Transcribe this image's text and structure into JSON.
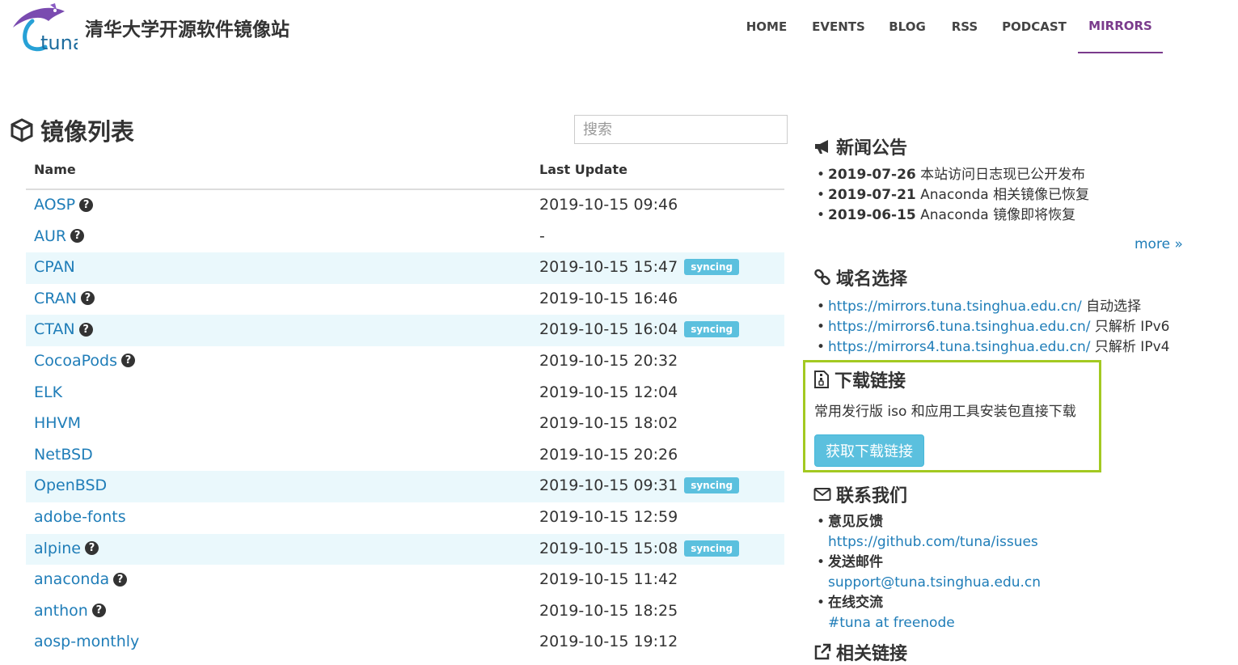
{
  "header": {
    "logo_text": "tuna",
    "site_title": "清华大学开源软件镜像站",
    "nav": [
      "HOME",
      "EVENTS",
      "BLOG",
      "RSS",
      "PODCAST",
      "MIRRORS"
    ],
    "active_nav": "MIRRORS"
  },
  "mirror_list": {
    "title": "镜像列表",
    "search_placeholder": "搜索",
    "col_name": "Name",
    "col_update": "Last Update",
    "rows": [
      {
        "name": "AOSP",
        "help": true,
        "update": "2019-10-15 09:46",
        "status": ""
      },
      {
        "name": "AUR",
        "help": true,
        "update": "-",
        "status": ""
      },
      {
        "name": "CPAN",
        "help": false,
        "update": "2019-10-15 15:47",
        "status": "syncing"
      },
      {
        "name": "CRAN",
        "help": true,
        "update": "2019-10-15 16:46",
        "status": ""
      },
      {
        "name": "CTAN",
        "help": true,
        "update": "2019-10-15 16:04",
        "status": "syncing"
      },
      {
        "name": "CocoaPods",
        "help": true,
        "update": "2019-10-15 20:32",
        "status": ""
      },
      {
        "name": "ELK",
        "help": false,
        "update": "2019-10-15 12:04",
        "status": ""
      },
      {
        "name": "HHVM",
        "help": false,
        "update": "2019-10-15 18:02",
        "status": ""
      },
      {
        "name": "NetBSD",
        "help": false,
        "update": "2019-10-15 20:26",
        "status": ""
      },
      {
        "name": "OpenBSD",
        "help": false,
        "update": "2019-10-15 09:31",
        "status": "syncing"
      },
      {
        "name": "adobe-fonts",
        "help": false,
        "update": "2019-10-15 12:59",
        "status": ""
      },
      {
        "name": "alpine",
        "help": true,
        "update": "2019-10-15 15:08",
        "status": "syncing"
      },
      {
        "name": "anaconda",
        "help": true,
        "update": "2019-10-15 11:42",
        "status": ""
      },
      {
        "name": "anthon",
        "help": true,
        "update": "2019-10-15 18:25",
        "status": ""
      },
      {
        "name": "aosp-monthly",
        "help": false,
        "update": "2019-10-15 19:12",
        "status": ""
      }
    ]
  },
  "sidebar": {
    "news_title": "新闻公告",
    "news": [
      {
        "date": "2019-07-26",
        "text": "本站访问日志现已公开发布"
      },
      {
        "date": "2019-07-21",
        "text": "Anaconda 相关镜像已恢复"
      },
      {
        "date": "2019-06-15",
        "text": "Anaconda 镜像即将恢复"
      }
    ],
    "more": "more »",
    "domain_title": "域名选择",
    "domains": [
      {
        "url": "https://mirrors.tuna.tsinghua.edu.cn/",
        "note": "自动选择"
      },
      {
        "url": "https://mirrors6.tuna.tsinghua.edu.cn/",
        "note": "只解析 IPv6"
      },
      {
        "url": "https://mirrors4.tuna.tsinghua.edu.cn/",
        "note": "只解析 IPv4"
      }
    ],
    "download_title": "下载链接",
    "download_desc": "常用发行版 iso 和应用工具安装包直接下载",
    "download_button": "获取下载链接",
    "contact_title": "联系我们",
    "contacts": [
      {
        "label": "意见反馈",
        "link": "https://github.com/tuna/issues"
      },
      {
        "label": "发送邮件",
        "link": "support@tuna.tsinghua.edu.cn"
      },
      {
        "label": "在线交流",
        "link": "#tuna at freenode"
      }
    ],
    "related_title": "相关链接"
  },
  "colors": {
    "link": "#1f7db8",
    "accent": "#7a3b8c",
    "syncing": "#5bc0de",
    "highlight": "#a3c921"
  }
}
